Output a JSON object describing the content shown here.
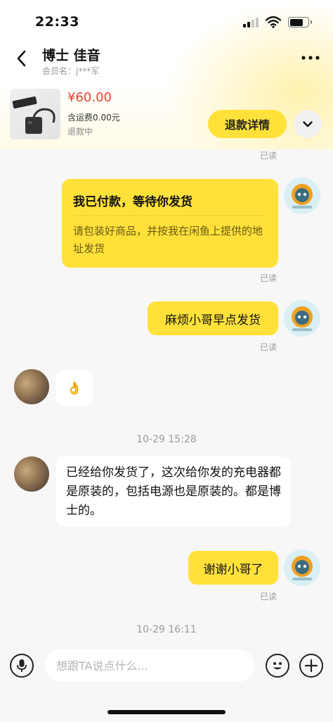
{
  "status_bar": {
    "time": "22:33"
  },
  "header": {
    "seller_name": "博士 佳音",
    "member_label": "会员名：j***军"
  },
  "product": {
    "price": "¥60.00",
    "shipping": "含运费0.00元",
    "status": "退款中",
    "refund_button": "退款详情"
  },
  "chat": {
    "read_label": "已读",
    "paid_card": {
      "title": "我已付款，等待你发货",
      "desc": "请包装好商品，并按我在闲鱼上提供的地址发货"
    },
    "msg_hurry": "麻烦小哥早点发货",
    "msg_ok_emoji": "👌",
    "timestamp_1": "10-29 15:28",
    "msg_shipped": "已经给你发货了，这次给你发的充电器都是原装的，包括电源也是原装的。都是博士的。",
    "msg_thanks": "谢谢小哥了",
    "timestamp_2": "10-29 16:11"
  },
  "input_bar": {
    "placeholder": "想跟TA说点什么..."
  },
  "colors": {
    "accent_yellow": "#ffe13a",
    "price_red": "#e8442d",
    "background": "#f7f7f7"
  },
  "icons": [
    "back-icon",
    "more-icon",
    "chevron-down-icon",
    "microphone-icon",
    "emoji-icon",
    "plus-icon",
    "signal-icon",
    "wifi-icon",
    "battery-icon"
  ]
}
